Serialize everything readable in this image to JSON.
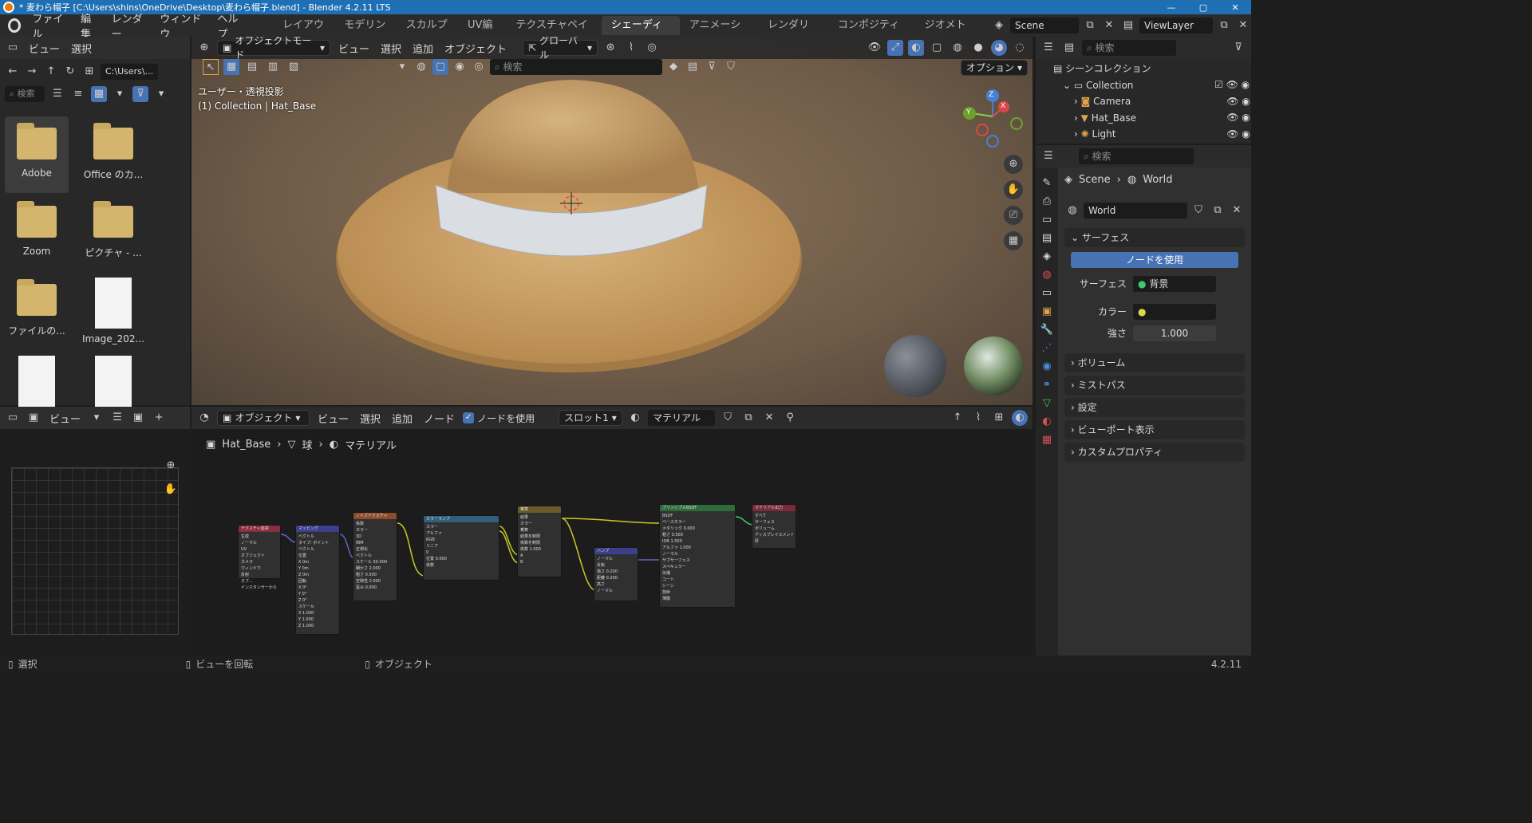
{
  "titlebar": {
    "title": "* 麦わら帽子 [C:\\Users\\shins\\OneDrive\\Desktop\\麦わら帽子.blend] - Blender 4.2.11 LTS",
    "buttons": [
      "—",
      "▢",
      "✕"
    ]
  },
  "menu": {
    "items": [
      "ファイル",
      "編集",
      "レンダー",
      "ウィンドウ",
      "ヘルプ"
    ]
  },
  "workspaces": [
    "レイアウト",
    "モデリング",
    "スカルプト",
    "UV編集",
    "テクスチャペイント",
    "シェーディング",
    "アニメーション",
    "レンダリング",
    "コンポジティング",
    "ジオメトリ..."
  ],
  "active_workspace": "シェーディング",
  "scene": "Scene",
  "viewlayer": "ViewLayer",
  "filebrowser": {
    "menu": [
      "ビュー",
      "選択"
    ],
    "path": "C:\\Users\\...",
    "search": "検索",
    "items": [
      {
        "name": "Adobe",
        "kind": "folder"
      },
      {
        "name": "Office のカ...",
        "kind": "folder"
      },
      {
        "name": "Zoom",
        "kind": "folder"
      },
      {
        "name": "ピクチャ - ...",
        "kind": "folder"
      },
      {
        "name": "ファイルの...",
        "kind": "folder"
      },
      {
        "name": "Image_202...",
        "kind": "image"
      },
      {
        "name": "",
        "kind": "image"
      },
      {
        "name": "",
        "kind": "image"
      }
    ]
  },
  "viewport": {
    "mode": "オブジェクトモード",
    "menu": [
      "ビュー",
      "選択",
      "追加",
      "オブジェクト"
    ],
    "orientation": "グローバル",
    "options": "オプション",
    "search": "検索",
    "info1": "ユーザー・透視投影",
    "info2": "(1) Collection | Hat_Base",
    "gizmo": {
      "z": "Z",
      "y": "Y",
      "x": "X"
    }
  },
  "image_editor": {
    "view": "ビュー"
  },
  "node_editor": {
    "mode": "オブジェクト",
    "menu": [
      "ビュー",
      "選択",
      "追加",
      "ノード"
    ],
    "use_nodes": "ノードを使用",
    "slot": "スロット1",
    "material": "マテリアル",
    "breadcrumb": [
      "Hat_Base",
      "球",
      "マテリアル"
    ],
    "nodes": [
      {
        "title": "テクスチャ座標",
        "color": "#8b2d3f",
        "lines": [
          "生成",
          "ノーマル",
          "UV",
          "オブジェクト",
          "カメラ",
          "ウィンドウ",
          "反射",
          "オブ...",
          "インスタンサーから"
        ]
      },
      {
        "title": "マッピング",
        "color": "#3b3f8c",
        "lines": [
          "ベクトル",
          "タイプ: ポイント",
          "ベクトル",
          "位置",
          "X 0m",
          "Y 0m",
          "Z 0m",
          "回転",
          "X 0°",
          "Y 0°",
          "Z 0°",
          "スケール",
          "X 1.000",
          "Y 1.000",
          "Z 1.000"
        ]
      },
      {
        "title": "ノイズテクスチャ",
        "color": "#8c4b2a",
        "lines": [
          "係数",
          "カラー",
          "3D",
          "fBM",
          "正規化",
          "ベクトル",
          "スケール 50.000",
          "細かさ 2.000",
          "粗さ 0.500",
          "空隙性 2.000",
          "歪み 0.000"
        ]
      },
      {
        "title": "カラーランプ",
        "color": "#2f5f7a",
        "lines": [
          "カラー",
          "アルファ",
          "RGB",
          "リニア",
          "0",
          "位置 0.000",
          "係数"
        ]
      },
      {
        "title": "乗算",
        "color": "#6a5a2a",
        "lines": [
          "結果",
          "カラー",
          "乗算",
          "結果を制限",
          "係数を制限",
          "係数 1.000",
          "A",
          "B"
        ]
      },
      {
        "title": "バンプ",
        "color": "#3b3f8c",
        "lines": [
          "ノーマル",
          "反転",
          "強さ 0.200",
          "距離 0.200",
          "高さ",
          "ノーマル"
        ]
      },
      {
        "title": "プリンシプルBSDF",
        "color": "#2e6b3a",
        "lines": [
          "BSDF",
          "ベースカラー",
          "メタリック 0.000",
          "粗さ 0.500",
          "IOR 1.500",
          "アルファ 1.000",
          "ノーマル",
          "サブサーフェス",
          "スペキュラー",
          "伝播",
          "コート",
          "シーン",
          "放射",
          "薄膜"
        ]
      },
      {
        "title": "マテリアル出力",
        "color": "#7a2a3a",
        "lines": [
          "すべて",
          "サーフェス",
          "ボリューム",
          "ディスプレイスメント",
          "厚"
        ]
      }
    ]
  },
  "outliner": {
    "search": "検索",
    "scene_collection": "シーンコレクション",
    "items": [
      {
        "name": "Collection",
        "indent": 1
      },
      {
        "name": "Camera",
        "indent": 2
      },
      {
        "name": "Hat_Base",
        "indent": 2
      },
      {
        "name": "Light",
        "indent": 2
      }
    ]
  },
  "properties": {
    "search": "検索",
    "breadcrumb": [
      "Scene",
      "World"
    ],
    "world": "World",
    "surface_section": "サーフェス",
    "use_nodes": "ノードを使用",
    "surface_label": "サーフェス",
    "surface_value": "背景",
    "color_label": "カラー",
    "strength_label": "強さ",
    "strength_value": "1.000",
    "sections": [
      "ボリューム",
      "ミストパス",
      "設定",
      "ビューポート表示",
      "カスタムプロパティ"
    ]
  },
  "status": {
    "select": "選択",
    "rotate": "ビューを回転",
    "object": "オブジェクト",
    "version": "4.2.11"
  },
  "colors": {
    "accent": "#4772b3",
    "titlebar": "#1f6fb5",
    "hat": "#c9a063",
    "band": "#dcdfe3"
  }
}
